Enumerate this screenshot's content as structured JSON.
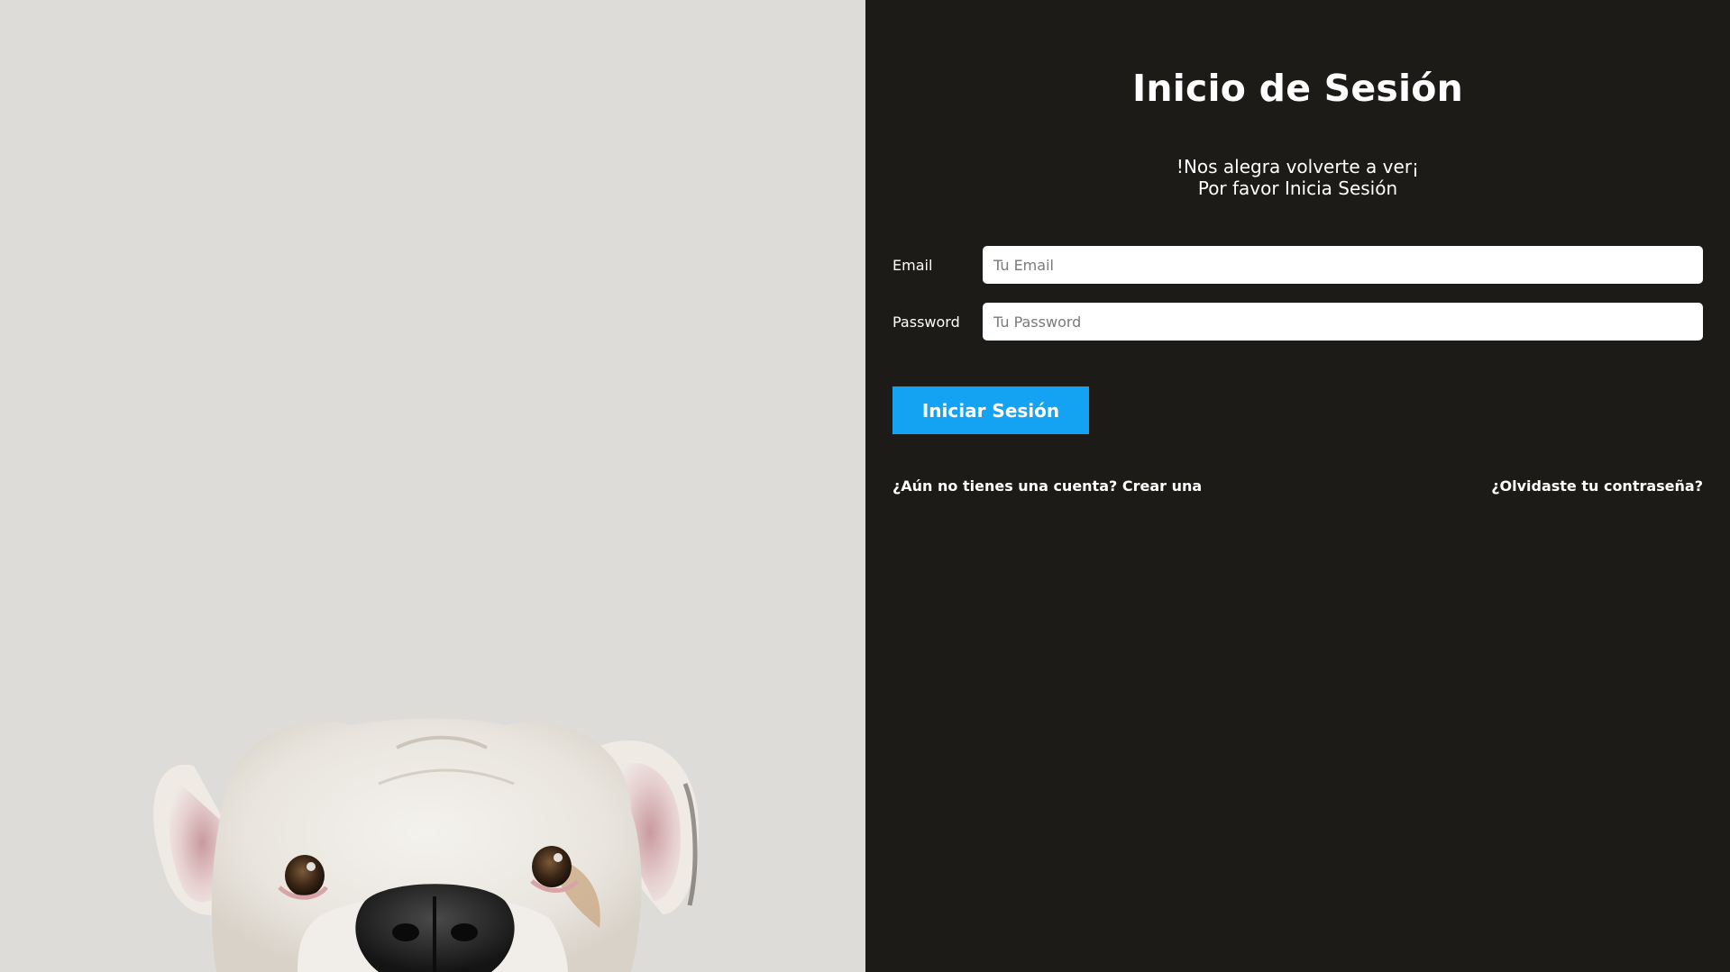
{
  "image_panel": {
    "alt": "Bulldog peeking from bottom",
    "background_color": "#dedcd8"
  },
  "form": {
    "title": "Inicio de Sesión",
    "subtitle_line1": "!Nos alegra volverte a ver¡",
    "subtitle_line2": "Por favor Inicia Sesión",
    "email": {
      "label": "Email",
      "placeholder": "Tu Email",
      "value": ""
    },
    "password": {
      "label": "Password",
      "placeholder": "Tu Password",
      "value": ""
    },
    "submit_label": "Iniciar Sesión",
    "create_account_link": "¿Aún no tienes una cuenta? Crear una",
    "forgot_password_link": "¿Olvidaste tu contraseña?"
  },
  "colors": {
    "panel_background": "#1c1b18",
    "button": "#13a3f2",
    "text": "#ffffff"
  }
}
